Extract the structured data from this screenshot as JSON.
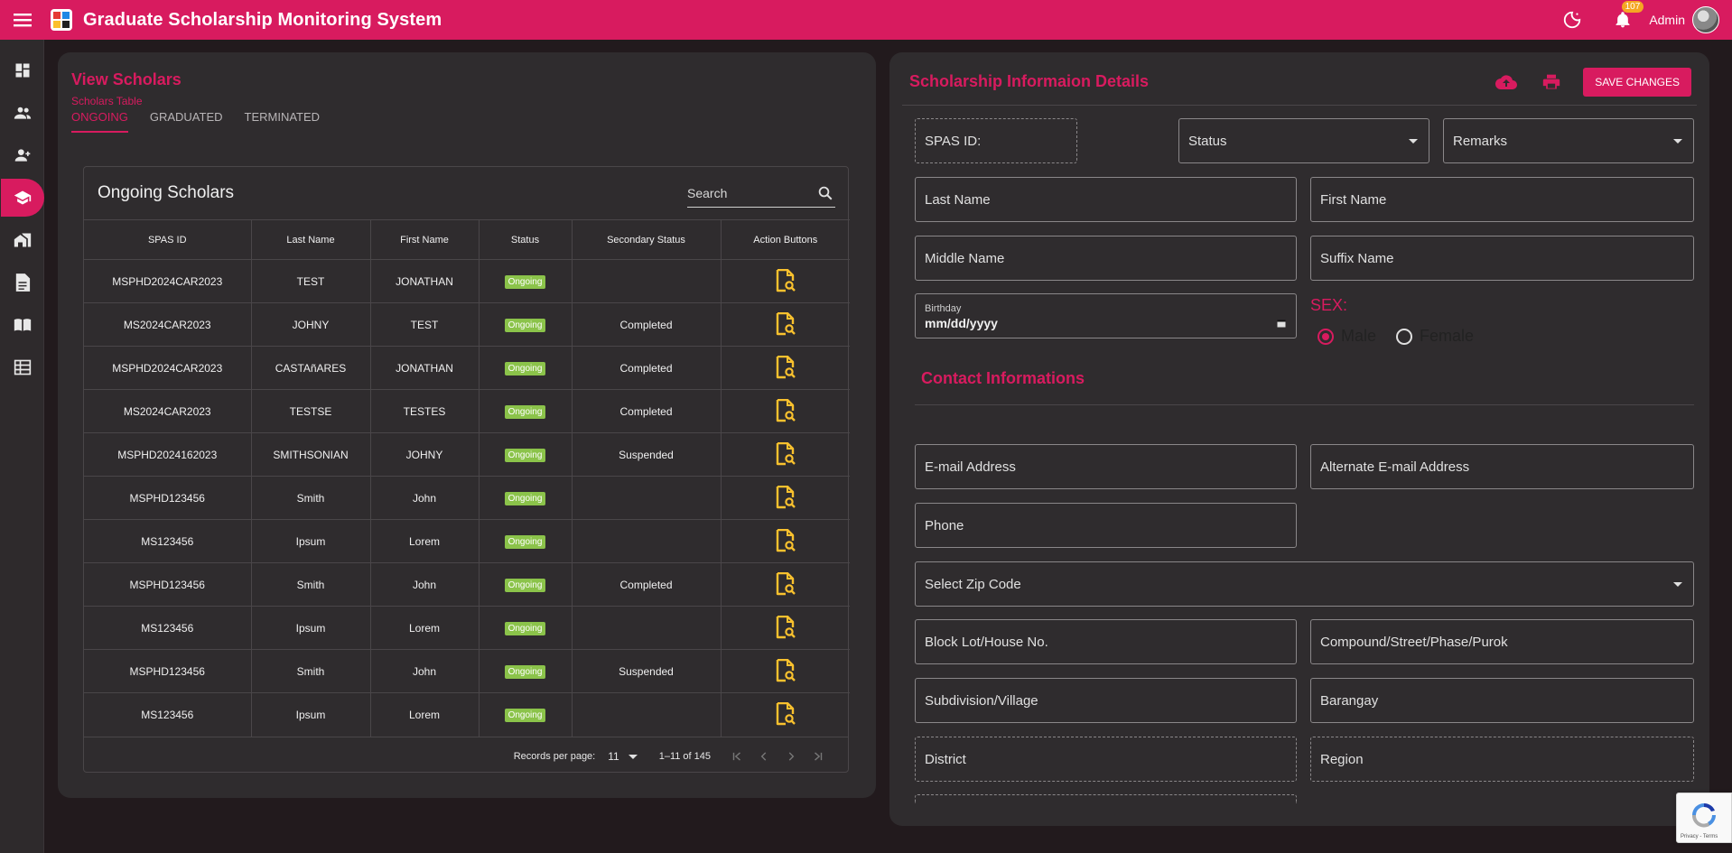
{
  "topbar": {
    "title": "Graduate Scholarship Monitoring System",
    "notification_count": "107",
    "user_label": "Admin"
  },
  "sidebar": {
    "items": [
      {
        "icon": "dashboard-icon"
      },
      {
        "icon": "people-icon"
      },
      {
        "icon": "add-user-icon"
      },
      {
        "icon": "graduation-cap-icon",
        "active": true
      },
      {
        "icon": "home-work-icon"
      },
      {
        "icon": "document-icon"
      },
      {
        "icon": "book-icon"
      },
      {
        "icon": "table-icon"
      }
    ]
  },
  "left": {
    "title": "View Scholars",
    "subtitle": "Scholars Table",
    "tabs": [
      "ONGOING",
      "GRADUATED",
      "TERMINATED"
    ],
    "active_tab": "ONGOING",
    "table_title": "Ongoing Scholars",
    "search_placeholder": "Search",
    "columns": [
      "SPAS ID",
      "Last Name",
      "First Name",
      "Status",
      "Secondary Status",
      "Action Buttons"
    ],
    "rows": [
      {
        "id": "MSPHD2024CAR2023",
        "last": "TEST",
        "first": "JONATHAN",
        "status": "Ongoing",
        "secondary": ""
      },
      {
        "id": "MS2024CAR2023",
        "last": "JOHNY",
        "first": "TEST",
        "status": "Ongoing",
        "secondary": "Completed"
      },
      {
        "id": "MSPHD2024CAR2023",
        "last": "CASTAñARES",
        "first": "JONATHAN",
        "status": "Ongoing",
        "secondary": "Completed"
      },
      {
        "id": "MS2024CAR2023",
        "last": "TESTSE",
        "first": "TESTES",
        "status": "Ongoing",
        "secondary": "Completed"
      },
      {
        "id": "MSPHD2024162023",
        "last": "SMITHSONIAN",
        "first": "JOHNY",
        "status": "Ongoing",
        "secondary": "Suspended"
      },
      {
        "id": "MSPHD123456",
        "last": "Smith",
        "first": "John",
        "status": "Ongoing",
        "secondary": ""
      },
      {
        "id": "MS123456",
        "last": "Ipsum",
        "first": "Lorem",
        "status": "Ongoing",
        "secondary": ""
      },
      {
        "id": "MSPHD123456",
        "last": "Smith",
        "first": "John",
        "status": "Ongoing",
        "secondary": "Completed"
      },
      {
        "id": "MS123456",
        "last": "Ipsum",
        "first": "Lorem",
        "status": "Ongoing",
        "secondary": ""
      },
      {
        "id": "MSPHD123456",
        "last": "Smith",
        "first": "John",
        "status": "Ongoing",
        "secondary": "Suspended"
      },
      {
        "id": "MS123456",
        "last": "Ipsum",
        "first": "Lorem",
        "status": "Ongoing",
        "secondary": ""
      }
    ],
    "pager": {
      "records_label": "Records per page:",
      "records_value": "11",
      "range": "1–11 of 145"
    }
  },
  "right": {
    "title": "Scholarship Informaion Details",
    "save_label": "SAVE CHANGES",
    "fields": {
      "spas_id": "SPAS ID:",
      "status": "Status",
      "remarks": "Remarks",
      "last_name": "Last Name",
      "first_name": "First Name",
      "middle_name": "Middle Name",
      "suffix_name": "Suffix Name",
      "birthday_label": "Birthday",
      "birthday_value": "mm/dd/yyyy",
      "email": "E-mail Address",
      "alt_email": "Alternate E-mail Address",
      "phone": "Phone",
      "zip": "Select Zip Code",
      "block": "Block Lot/House No.",
      "street": "Compound/Street/Phase/Purok",
      "subdivision": "Subdivision/Village",
      "barangay": "Barangay",
      "district": "District",
      "region": "Region"
    },
    "sex_label": "SEX:",
    "sex_options": [
      "Male",
      "Female"
    ],
    "sex_selected": "Male",
    "contact_title": "Contact Informations"
  },
  "recaptcha": {
    "text": "Privacy - Terms"
  },
  "colors": {
    "accent": "#d81b5f",
    "badge": "#8bc34a",
    "action_icon": "#f9c12e"
  }
}
